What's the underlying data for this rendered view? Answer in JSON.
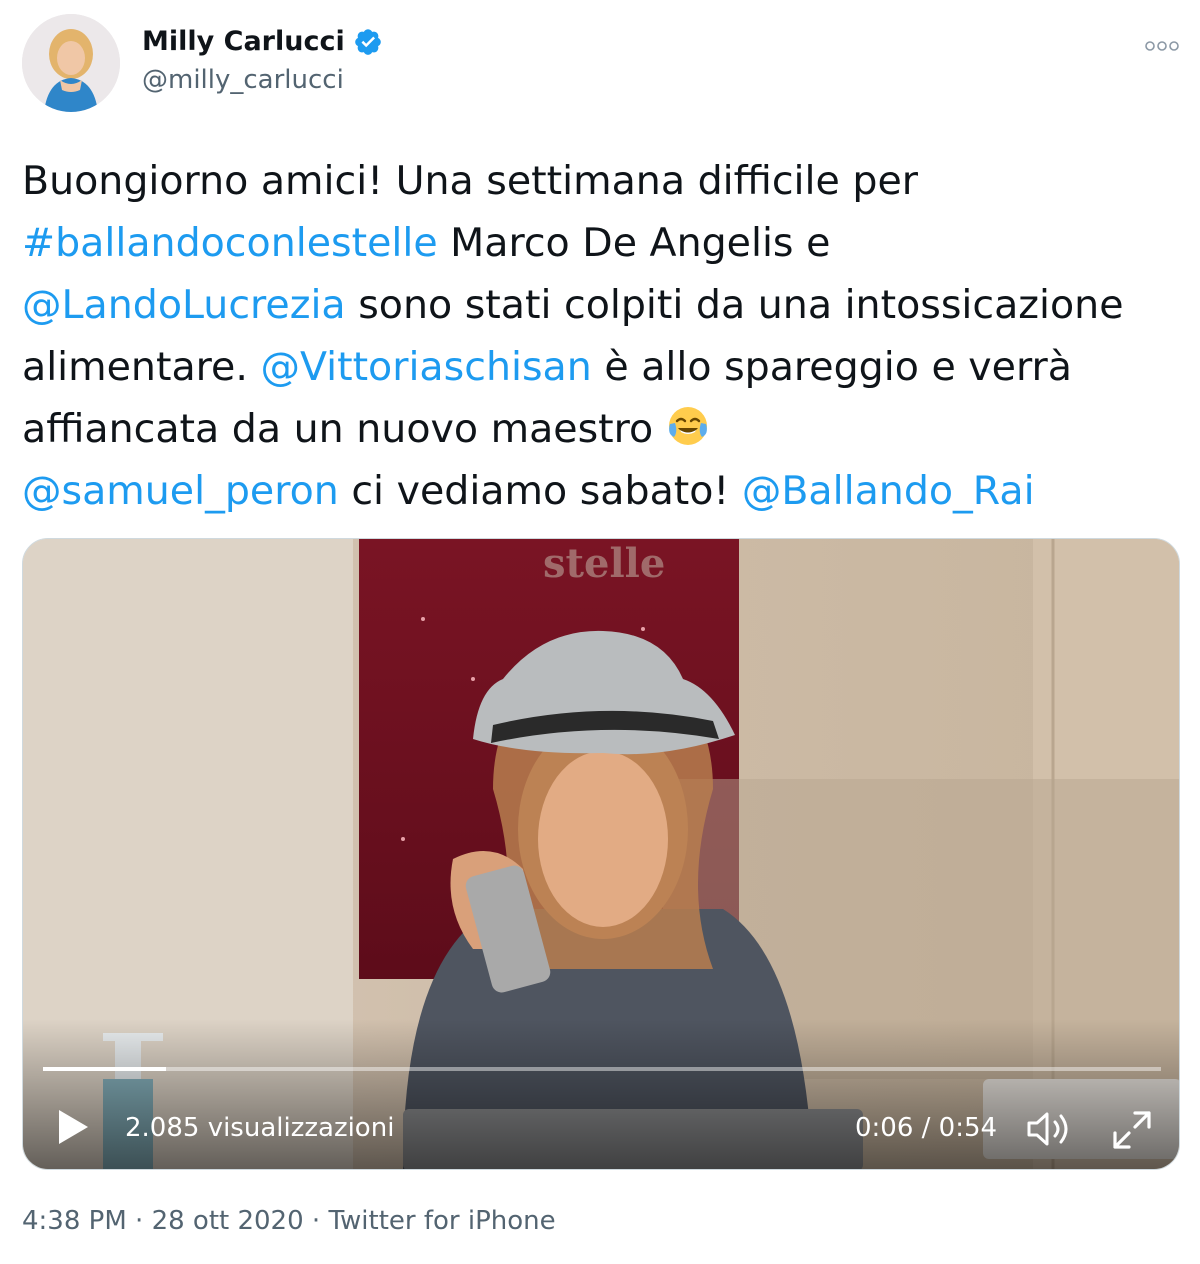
{
  "author": {
    "display_name": "Milly Carlucci",
    "handle": "@milly_carlucci",
    "verified": true,
    "avatar_icon": "profile-photo"
  },
  "tweet": {
    "segments": [
      {
        "text": "Buongiorno amici! Una settimana difficile per ",
        "type": "text"
      },
      {
        "text": "#ballandoconlestelle",
        "type": "hashtag"
      },
      {
        "text": " Marco De Angelis e ",
        "type": "text"
      },
      {
        "text": "@LandoLucrezia",
        "type": "mention"
      },
      {
        "text": " sono stati colpiti da una intossicazione alimentare. ",
        "type": "text"
      },
      {
        "text": "@Vittoriaschisan",
        "type": "mention"
      },
      {
        "text": " è allo spareggio e verrà affiancata da un nuovo maestro ",
        "type": "text"
      },
      {
        "text": "@samuel_peron",
        "type": "mention"
      },
      {
        "text": " ci vediamo sabato! ",
        "type": "text"
      },
      {
        "text": "@Ballando_Rai",
        "type": "mention"
      }
    ],
    "emoji": "face-with-tears-of-joy"
  },
  "video": {
    "views": "2.085 visualizzazioni",
    "time": "0:06 / 0:54",
    "progress_fraction": 0.11,
    "banner_text": "stelle"
  },
  "footer": {
    "time": "4:38 PM",
    "separator": " · ",
    "date": "28 ott 2020",
    "source": "Twitter for iPhone"
  },
  "colors": {
    "link": "#1d9bf0",
    "secondary": "#536471",
    "verified": "#1d9bf0"
  }
}
